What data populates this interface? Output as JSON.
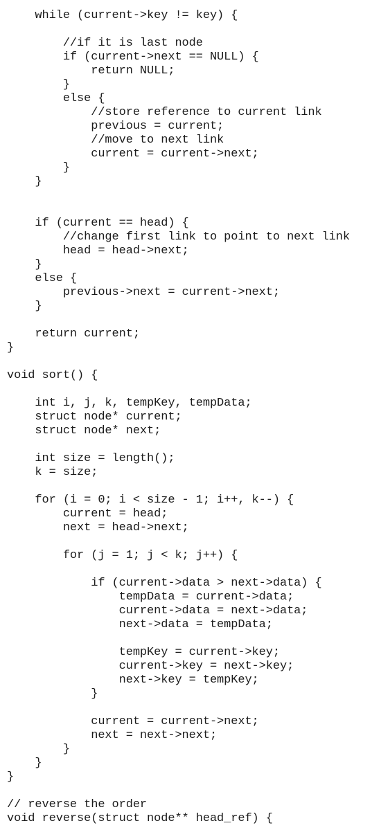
{
  "document": {
    "language": "c",
    "lines": [
      "    while (current->key != key) {",
      "",
      "        //if it is last node",
      "        if (current->next == NULL) {",
      "            return NULL;",
      "        }",
      "        else {",
      "            //store reference to current link",
      "            previous = current;",
      "            //move to next link",
      "            current = current->next;",
      "        }",
      "    }",
      "",
      "",
      "    if (current == head) {",
      "        //change first link to point to next link",
      "        head = head->next;",
      "    }",
      "    else {",
      "        previous->next = current->next;",
      "    }",
      "",
      "    return current;",
      "}",
      "",
      "void sort() {",
      "",
      "    int i, j, k, tempKey, tempData;",
      "    struct node* current;",
      "    struct node* next;",
      "",
      "    int size = length();",
      "    k = size;",
      "",
      "    for (i = 0; i < size - 1; i++, k--) {",
      "        current = head;",
      "        next = head->next;",
      "",
      "        for (j = 1; j < k; j++) {",
      "",
      "            if (current->data > next->data) {",
      "                tempData = current->data;",
      "                current->data = next->data;",
      "                next->data = tempData;",
      "",
      "                tempKey = current->key;",
      "                current->key = next->key;",
      "                next->key = tempKey;",
      "            }",
      "",
      "            current = current->next;",
      "            next = next->next;",
      "        }",
      "    }",
      "}",
      "",
      "// reverse the order",
      "void reverse(struct node** head_ref) {"
    ]
  }
}
